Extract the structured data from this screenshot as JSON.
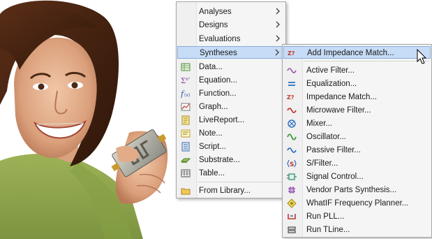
{
  "main_menu": {
    "items": [
      {
        "label": "Analyses",
        "has_submenu": true,
        "icon": "none"
      },
      {
        "label": "Designs",
        "has_submenu": true,
        "icon": "none"
      },
      {
        "label": "Evaluations",
        "has_submenu": true,
        "icon": "none"
      },
      {
        "label": "Syntheses",
        "has_submenu": true,
        "icon": "none",
        "highlighted": true
      },
      {
        "label": "Data...",
        "icon": "data-table-icon"
      },
      {
        "label": "Equation...",
        "icon": "equation-icon"
      },
      {
        "label": "Function...",
        "icon": "function-icon"
      },
      {
        "label": "Graph...",
        "icon": "graph-icon"
      },
      {
        "label": "LiveReport...",
        "icon": "livereport-icon"
      },
      {
        "label": "Note...",
        "icon": "note-icon"
      },
      {
        "label": "Script...",
        "icon": "script-icon"
      },
      {
        "label": "Substrate...",
        "icon": "substrate-icon"
      },
      {
        "label": "Table...",
        "icon": "table-icon"
      },
      {
        "label": "From Library...",
        "icon": "folder-icon"
      }
    ]
  },
  "sub_menu": {
    "items": [
      {
        "label": "Add Impedance Match...",
        "icon": "impedance-match-icon",
        "highlighted": true
      },
      {
        "label": "Active Filter...",
        "icon": "active-filter-icon"
      },
      {
        "label": "Equalization...",
        "icon": "equalization-icon"
      },
      {
        "label": "Impedance Match...",
        "icon": "impedance-match-icon"
      },
      {
        "label": "Microwave Filter...",
        "icon": "microwave-filter-icon"
      },
      {
        "label": "Mixer...",
        "icon": "mixer-icon"
      },
      {
        "label": "Oscillator...",
        "icon": "oscillator-icon"
      },
      {
        "label": "Passive Filter...",
        "icon": "passive-filter-icon"
      },
      {
        "label": "S/Filter...",
        "icon": "s-filter-icon"
      },
      {
        "label": "Signal Control...",
        "icon": "signal-control-icon"
      },
      {
        "label": "Vendor Parts Synthesis...",
        "icon": "vendor-parts-icon"
      },
      {
        "label": "WhatIF Frequency Planner...",
        "icon": "whatif-planner-icon"
      },
      {
        "label": "Run PLL...",
        "icon": "run-pll-icon"
      },
      {
        "label": "Run TLine...",
        "icon": "run-tline-icon"
      }
    ]
  },
  "colors": {
    "menu_bg": "#f5f5f5",
    "highlight_bg": "#c7dcf6",
    "highlight_border": "#84acdd",
    "sweater": "#8fa84a"
  }
}
